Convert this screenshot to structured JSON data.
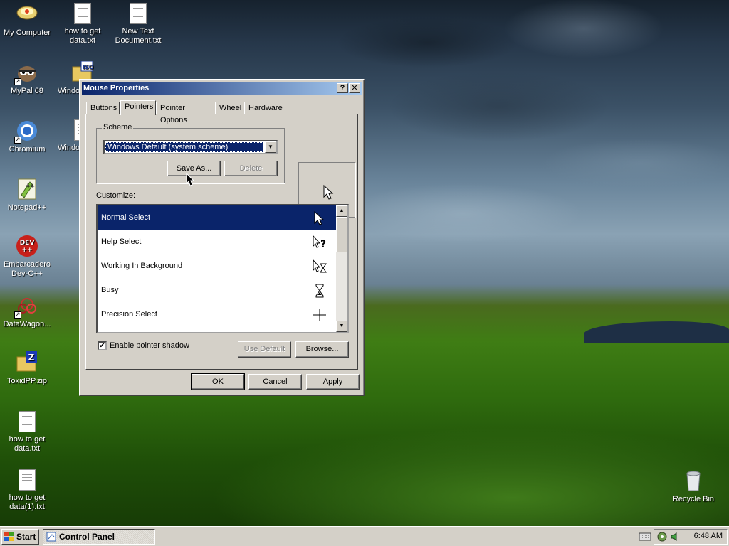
{
  "desktop": {
    "icons": [
      {
        "label": "My Computer",
        "icon": "my-computer-icon"
      },
      {
        "label": "how to get data.txt",
        "icon": "text-file-icon"
      },
      {
        "label": "New Text Document.txt",
        "icon": "text-file-icon"
      },
      {
        "label": "MyPal 68",
        "icon": "mypal-browser-icon"
      },
      {
        "label": "Windo",
        "icon": "iso-folder-icon",
        "badge": "ISO"
      },
      {
        "label": "Chromium",
        "icon": "chromium-icon"
      },
      {
        "label": "Windo",
        "icon": "document-icon"
      },
      {
        "label": "Notepad++",
        "icon": "notepadpp-icon",
        "badge": "++"
      },
      {
        "label": "Embarcadero Dev-C++",
        "icon": "devcpp-icon",
        "badge": "DEV ++"
      },
      {
        "label": "DataWagon...",
        "icon": "datawagon-icon"
      },
      {
        "label": "ToxidPP.zip",
        "icon": "zip-folder-icon",
        "badge": "Z"
      },
      {
        "label": "how to get data.txt",
        "icon": "text-file-icon"
      },
      {
        "label": "how to get data(1).txt",
        "icon": "text-file-icon"
      },
      {
        "label": "Recycle Bin",
        "icon": "recycle-bin-icon"
      }
    ]
  },
  "dialog": {
    "title": "Mouse Properties",
    "help_button": "?",
    "close_button": "✕",
    "tabs": [
      "Buttons",
      "Pointers",
      "Pointer Options",
      "Wheel",
      "Hardware"
    ],
    "active_tab": "Pointers",
    "scheme": {
      "group_label": "Scheme",
      "selected_value": "Windows Default (system scheme)",
      "save_as": "Save As...",
      "delete": "Delete"
    },
    "customize_label": "Customize:",
    "pointer_list": [
      {
        "label": "Normal Select",
        "icon": "arrow-pointer-icon",
        "selected": true
      },
      {
        "label": "Help Select",
        "icon": "help-pointer-icon",
        "selected": false
      },
      {
        "label": "Working In Background",
        "icon": "working-pointer-icon",
        "selected": false
      },
      {
        "label": "Busy",
        "icon": "hourglass-icon",
        "selected": false
      },
      {
        "label": "Precision Select",
        "icon": "crosshair-icon",
        "selected": false
      }
    ],
    "shadow_checkbox": {
      "label": "Enable pointer shadow",
      "checked": true
    },
    "use_default": "Use Default",
    "browse": "Browse...",
    "ok": "OK",
    "cancel": "Cancel",
    "apply": "Apply"
  },
  "taskbar": {
    "start": "Start",
    "task": "Control Panel",
    "clock": "6:48 AM"
  },
  "colors": {
    "title_active": "#0a246a",
    "title_gradient_end": "#a6caf0",
    "face": "#d4d0c8",
    "selection": "#0a246a"
  }
}
